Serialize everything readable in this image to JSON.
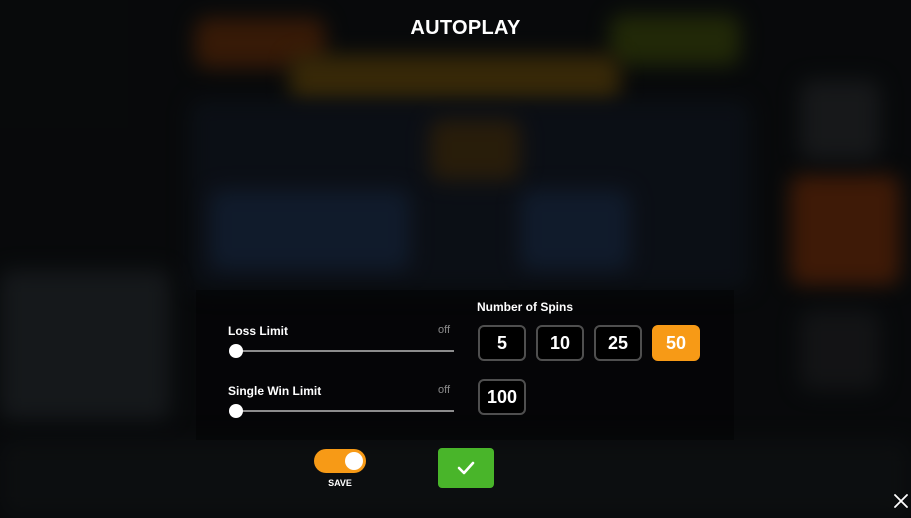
{
  "title": "AUTOPLAY",
  "limits": [
    {
      "label": "Loss Limit",
      "value": "off",
      "level": 0
    },
    {
      "label": "Single Win Limit",
      "value": "off",
      "level": 0
    }
  ],
  "spins": {
    "label": "Number of Spins",
    "options": [
      "5",
      "10",
      "25",
      "50",
      "100"
    ],
    "selected": "50"
  },
  "save": {
    "label": "SAVE",
    "on": true
  },
  "colors": {
    "accent": "#f79a16",
    "confirm": "#49b52a"
  },
  "icons": {
    "confirm": "check-icon",
    "close": "close-icon"
  }
}
